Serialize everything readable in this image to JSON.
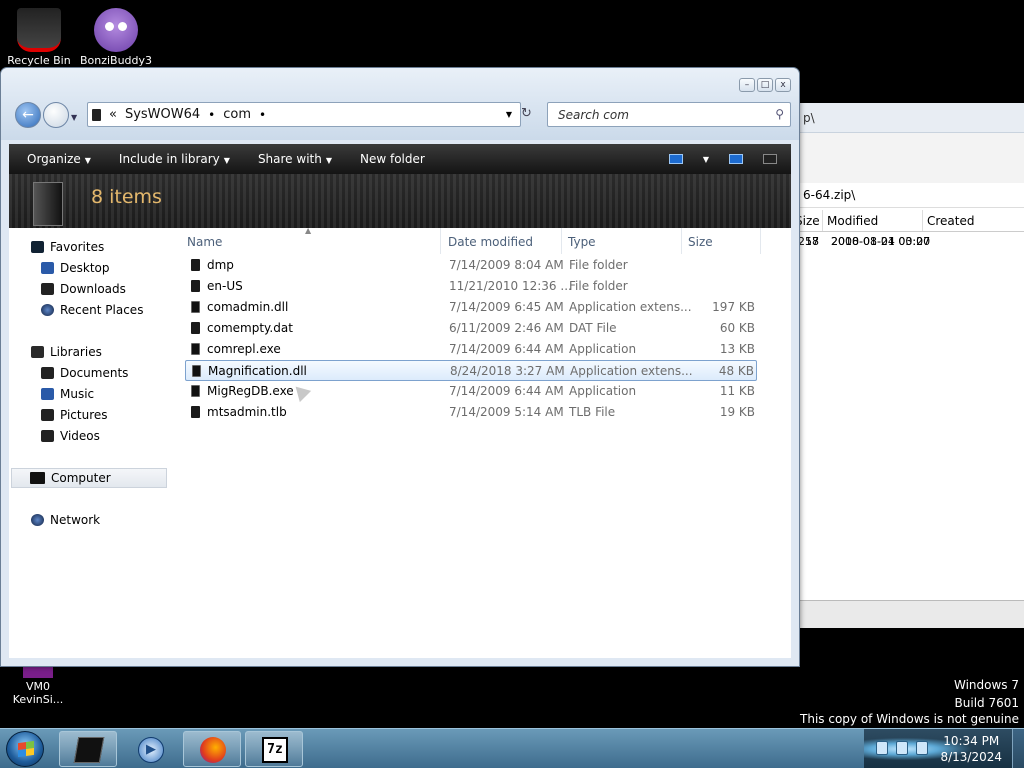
{
  "desktop": {
    "icons": [
      {
        "label": "Recycle Bin"
      },
      {
        "label": "BonziBuddy3"
      },
      {
        "label": "VM0\nKevinSi..."
      }
    ],
    "watermark": {
      "line1": "Windows 7",
      "line2": "Build 7601",
      "line3": "This copy of Windows is not genuine"
    }
  },
  "background_window": {
    "address_fragment": "p\\",
    "path_fragment": "6-64.zip\\",
    "columns": [
      "Size",
      "Modified",
      "Created"
    ],
    "rows": [
      {
        "size": "58",
        "modified": "2000-01-01 00:00"
      },
      {
        "size": "217",
        "modified": "2018-08-24 03:27"
      }
    ]
  },
  "explorer": {
    "caption_buttons": {
      "minimize": "–",
      "maximize": "□",
      "close": "x"
    },
    "breadcrumb": {
      "overflow": "«",
      "parts": [
        "SysWOW64",
        "com"
      ]
    },
    "search_placeholder": "Search com",
    "toolbar": {
      "organize": "Organize",
      "include_in_library": "Include in library",
      "share_with": "Share with",
      "new_folder": "New folder"
    },
    "item_count": "8 items",
    "nav": {
      "favorites": "Favorites",
      "desktop": "Desktop",
      "downloads": "Downloads",
      "recent_places": "Recent Places",
      "libraries": "Libraries",
      "documents": "Documents",
      "music": "Music",
      "pictures": "Pictures",
      "videos": "Videos",
      "computer": "Computer",
      "network": "Network"
    },
    "columns": {
      "name": "Name",
      "date_modified": "Date modified",
      "type": "Type",
      "size": "Size"
    },
    "files": [
      {
        "name": "dmp",
        "date": "7/14/2009 8:04 AM",
        "type": "File folder",
        "size": "",
        "icon": "folder-icon"
      },
      {
        "name": "en-US",
        "date": "11/21/2010 12:36 ...",
        "type": "File folder",
        "size": "",
        "icon": "folder-icon"
      },
      {
        "name": "comadmin.dll",
        "date": "7/14/2009 6:45 AM",
        "type": "Application extens...",
        "size": "197 KB",
        "icon": "dll-icon"
      },
      {
        "name": "comempty.dat",
        "date": "6/11/2009 2:46 AM",
        "type": "DAT File",
        "size": "60 KB",
        "icon": "file-icon"
      },
      {
        "name": "comrepl.exe",
        "date": "7/14/2009 6:44 AM",
        "type": "Application",
        "size": "13 KB",
        "icon": "exe-icon"
      },
      {
        "name": "Magnification.dll",
        "date": "8/24/2018 3:27 AM",
        "type": "Application extens...",
        "size": "48 KB",
        "icon": "dll-icon",
        "selected": true
      },
      {
        "name": "MigRegDB.exe",
        "date": "7/14/2009 6:44 AM",
        "type": "Application",
        "size": "11 KB",
        "icon": "exe-icon"
      },
      {
        "name": "mtsadmin.tlb",
        "date": "7/14/2009 5:14 AM",
        "type": "TLB File",
        "size": "19 KB",
        "icon": "file-icon"
      }
    ]
  },
  "taskbar": {
    "z_label": "7z",
    "clock_time": "10:34 PM",
    "clock_date": "8/13/2024"
  }
}
